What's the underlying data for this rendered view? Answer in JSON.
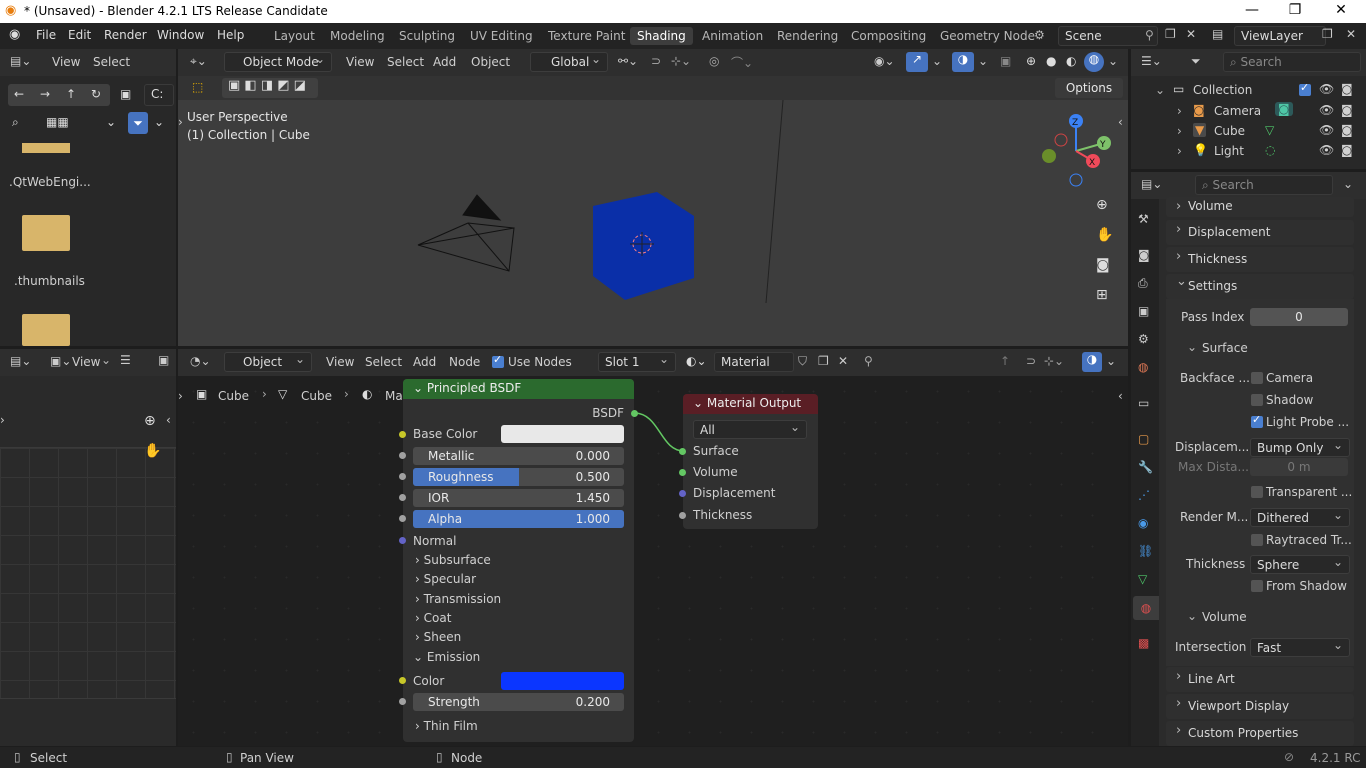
{
  "title": "* (Unsaved) - Blender 4.2.1 LTS Release Candidate",
  "menu": [
    "File",
    "Edit",
    "Render",
    "Window",
    "Help"
  ],
  "workspaces": [
    "Layout",
    "Modeling",
    "Sculpting",
    "UV Editing",
    "Texture Paint",
    "Shading",
    "Animation",
    "Rendering",
    "Compositing",
    "Geometry Node"
  ],
  "active_workspace": "Shading",
  "scene": "Scene",
  "viewlayer": "ViewLayer",
  "filebrowser": {
    "view": "View",
    "select": "Select",
    "path": "C:",
    "items": [
      ".QtWebEngi...",
      ".thumbnails"
    ]
  },
  "viewport": {
    "mode": "Object Mode",
    "menus": [
      "View",
      "Select",
      "Add",
      "Object"
    ],
    "orientation": "Global",
    "options": "Options",
    "info1": "User Perspective",
    "info2": "(1) Collection | Cube",
    "gizmo": {
      "x": "X",
      "y": "Y",
      "z": "Z"
    }
  },
  "outliner": {
    "search": "Search",
    "collection": "Collection",
    "items": [
      "Camera",
      "Cube",
      "Light"
    ]
  },
  "imageeditor": {
    "view": "View"
  },
  "nodeeditor": {
    "object": "Object",
    "menus": [
      "View",
      "Select",
      "Add",
      "Node"
    ],
    "use_nodes": "Use Nodes",
    "slot": "Slot 1",
    "material": "Material",
    "breadcrumb": [
      "Cube",
      "Cube",
      "Material"
    ]
  },
  "bsdf": {
    "title": "Principled BSDF",
    "out": "BSDF",
    "base_color": "Base Color",
    "metallic": {
      "label": "Metallic",
      "value": "0.000",
      "fill": 0
    },
    "roughness": {
      "label": "Roughness",
      "value": "0.500",
      "fill": 0.5
    },
    "ior": {
      "label": "IOR",
      "value": "1.450",
      "fill": 0
    },
    "alpha": {
      "label": "Alpha",
      "value": "1.000",
      "fill": 1
    },
    "normal": "Normal",
    "subsections": [
      "Subsurface",
      "Specular",
      "Transmission",
      "Coat",
      "Sheen"
    ],
    "emission": "Emission",
    "color": "Color",
    "strength": {
      "label": "Strength",
      "value": "0.200",
      "fill": 0
    },
    "thinfilm": "Thin Film"
  },
  "matout": {
    "title": "Material Output",
    "target": "All",
    "inputs": [
      "Surface",
      "Volume",
      "Displacement",
      "Thickness"
    ]
  },
  "props": {
    "search": "Search",
    "volume": "Volume",
    "displacement": "Displacement",
    "thickness": "Thickness",
    "settings": "Settings",
    "pass_index": "Pass Index",
    "pass_value": "0",
    "surface": "Surface",
    "backface": "Backface ...",
    "camera": "Camera",
    "shadow": "Shadow",
    "lightprobe": "Light Probe ...",
    "displacem": "Displacem...",
    "bump_only": "Bump Only",
    "max_dista": "Max Dista...",
    "max_val": "0 m",
    "transparent": "Transparent ...",
    "render_m": "Render M...",
    "dithered": "Dithered",
    "raytraced": "Raytraced Tr...",
    "thickness_lbl": "Thickness",
    "sphere": "Sphere",
    "from_shadow": "From Shadow",
    "volume2": "Volume",
    "intersection": "Intersection",
    "fast": "Fast",
    "line_art": "Line Art",
    "viewport_display": "Viewport Display",
    "custom_props": "Custom Properties"
  },
  "status": {
    "select": "Select",
    "pan": "Pan View",
    "node": "Node",
    "version": "4.2.1 RC"
  },
  "colors": {
    "accent": "#4673c0",
    "bsdf_header": "#2b6a2e",
    "matout_header": "#5a1e25",
    "emission": "#0b36ff",
    "cube": "#0a2fa8"
  }
}
